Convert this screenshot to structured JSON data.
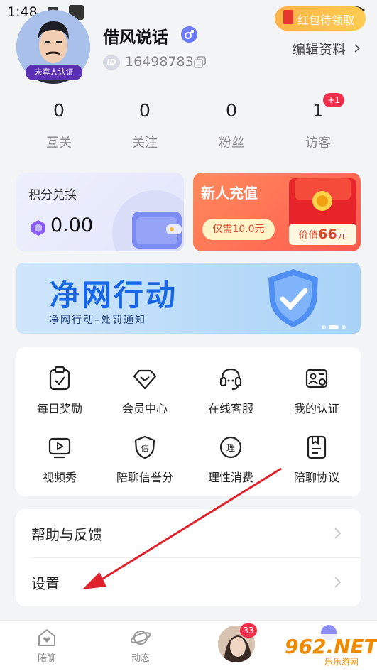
{
  "status_bar": {
    "time": "1:48",
    "notif_letter": "A"
  },
  "profile": {
    "avatar_badge": "未真人认证",
    "username": "借风说话",
    "id_tag": "ID",
    "user_id": "16498783",
    "redpack_label": "红包待领取",
    "edit_label": "编辑资料"
  },
  "stats": [
    {
      "value": "0",
      "label": "互关"
    },
    {
      "value": "0",
      "label": "关注"
    },
    {
      "value": "0",
      "label": "粉丝"
    },
    {
      "value": "1",
      "label": "访客"
    }
  ],
  "visitor_badge": "+1",
  "points_card": {
    "title": "积分兑换",
    "value": "0.00"
  },
  "recharge_card": {
    "title": "新人充值",
    "button": "仅需10.0元",
    "value_prefix": "价值",
    "value_amount": "66",
    "value_suffix": "元"
  },
  "banner": {
    "title": "净网行动",
    "subtitle": "净网行动–处罚通知"
  },
  "grid": [
    {
      "label": "每日奖励",
      "icon": "clipboard-check-icon"
    },
    {
      "label": "会员中心",
      "icon": "diamond-icon"
    },
    {
      "label": "在线客服",
      "icon": "headset-icon"
    },
    {
      "label": "我的认证",
      "icon": "id-card-icon"
    },
    {
      "label": "视频秀",
      "icon": "video-play-icon"
    },
    {
      "label": "陪聊信誉分",
      "icon": "credit-shield-icon"
    },
    {
      "label": "理性消费",
      "icon": "rational-spend-icon"
    },
    {
      "label": "陪聊协议",
      "icon": "agreement-doc-icon"
    }
  ],
  "grid_icon_glyphs": {
    "credit": "信",
    "rational": "理"
  },
  "list": [
    {
      "label": "帮助与反馈"
    },
    {
      "label": "设置"
    }
  ],
  "tabbar": {
    "tabs": [
      {
        "label": "陪聊",
        "icon": "heart-home-icon"
      },
      {
        "label": "动态",
        "icon": "planet-icon"
      }
    ],
    "message_badge": "33"
  },
  "watermark": {
    "main": "962.NET",
    "sub": "乐乐游网"
  },
  "colors": {
    "accent": "#6b7cf6",
    "badge_red": "#f0304b",
    "recharge": "#ff6a50",
    "banner_text": "#1767e6"
  }
}
